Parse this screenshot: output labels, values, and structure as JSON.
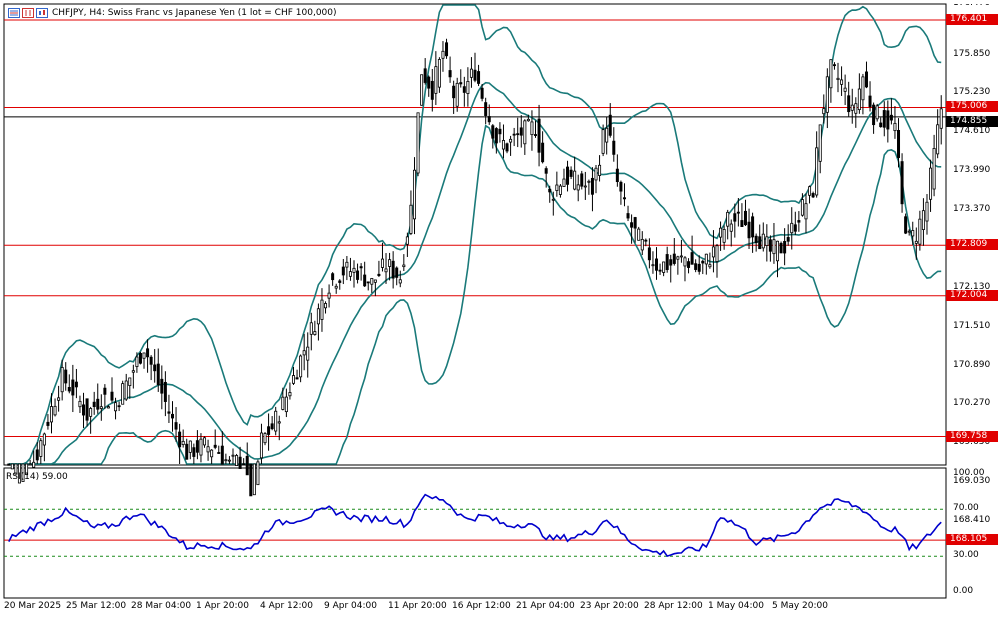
{
  "window": {
    "title": "CHFJPY, H4:  Swiss Franc vs Japanese Yen (1 lot = CHF 100,000)",
    "toolbar_icons": [
      "menu-icon",
      "bars-icon",
      "candles-icon"
    ]
  },
  "price_axis": {
    "ticks": [
      "175.850",
      "175.230",
      "174.610",
      "173.990",
      "173.370",
      "172.750",
      "172.130",
      "171.510",
      "170.890",
      "170.270",
      "169.650",
      "169.030",
      "168.410"
    ],
    "top_tick_partial": "176.470"
  },
  "horizontal_lines": [
    {
      "price": 176.401,
      "label": "176.401"
    },
    {
      "price": 175.006,
      "label": "175.006"
    },
    {
      "price": 172.809,
      "label": "172.809"
    },
    {
      "price": 172.004,
      "label": "172.004"
    },
    {
      "price": 169.758,
      "label": "169.758"
    },
    {
      "price": 168.105,
      "label": "168.105"
    }
  ],
  "current_price_label": "174.855",
  "rsi": {
    "label": "RSI(14) 59.00",
    "period": 14,
    "value": 59.0,
    "ticks": [
      "100.00",
      "70.00",
      "30.00",
      "0.00"
    ],
    "levels": [
      70,
      30
    ]
  },
  "time_axis": [
    "20 Mar 2025",
    "25 Mar 12:00",
    "28 Mar 04:00",
    "1 Apr 20:00",
    "4 Apr 12:00",
    "9 Apr 04:00",
    "11 Apr 20:00",
    "16 Apr 12:00",
    "21 Apr 04:00",
    "23 Apr 20:00",
    "28 Apr 12:00",
    "1 May 04:00",
    "5 May 20:00"
  ],
  "colors": {
    "bull": "#ffffff",
    "bear": "#000000",
    "bollinger": "#1a7a7a",
    "level_line": "#e00000",
    "rsi_line": "#0000cc",
    "rsi_level": "#1a8a1a",
    "badge_bg": "#e00000",
    "current_badge_bg": "#000000"
  },
  "chart_data": {
    "type": "candlestick",
    "symbol": "CHFJPY",
    "timeframe": "H4",
    "indicators": [
      "Bollinger Bands",
      "RSI(14)"
    ],
    "ylim": [
      168.1,
      176.5
    ],
    "close_path": [
      {
        "i": 0,
        "close": 168.6
      },
      {
        "i": 4,
        "close": 169.0
      },
      {
        "i": 8,
        "close": 169.5
      },
      {
        "i": 12,
        "close": 170.2
      },
      {
        "i": 15,
        "close": 170.7
      },
      {
        "i": 18,
        "close": 170.5
      },
      {
        "i": 22,
        "close": 170.1
      },
      {
        "i": 26,
        "close": 170.4
      },
      {
        "i": 30,
        "close": 170.3
      },
      {
        "i": 34,
        "close": 170.7
      },
      {
        "i": 38,
        "close": 171.2
      },
      {
        "i": 42,
        "close": 170.6
      },
      {
        "i": 46,
        "close": 170.0
      },
      {
        "i": 50,
        "close": 169.5
      },
      {
        "i": 54,
        "close": 169.6
      },
      {
        "i": 58,
        "close": 169.6
      },
      {
        "i": 62,
        "close": 169.3
      },
      {
        "i": 66,
        "close": 169.4
      },
      {
        "i": 68,
        "close": 168.6
      },
      {
        "i": 71,
        "close": 169.7
      },
      {
        "i": 74,
        "close": 169.9
      },
      {
        "i": 78,
        "close": 170.4
      },
      {
        "i": 82,
        "close": 171.0
      },
      {
        "i": 86,
        "close": 171.6
      },
      {
        "i": 90,
        "close": 172.2
      },
      {
        "i": 94,
        "close": 172.4
      },
      {
        "i": 98,
        "close": 172.4
      },
      {
        "i": 102,
        "close": 172.2
      },
      {
        "i": 106,
        "close": 172.5
      },
      {
        "i": 110,
        "close": 172.3
      },
      {
        "i": 113,
        "close": 173.4
      },
      {
        "i": 116,
        "close": 175.6
      },
      {
        "i": 119,
        "close": 175.3
      },
      {
        "i": 122,
        "close": 175.9
      },
      {
        "i": 125,
        "close": 175.2
      },
      {
        "i": 128,
        "close": 175.3
      },
      {
        "i": 131,
        "close": 175.6
      },
      {
        "i": 134,
        "close": 175.0
      },
      {
        "i": 137,
        "close": 174.5
      },
      {
        "i": 140,
        "close": 174.4
      },
      {
        "i": 144,
        "close": 174.6
      },
      {
        "i": 148,
        "close": 174.7
      },
      {
        "i": 152,
        "close": 173.6
      },
      {
        "i": 156,
        "close": 173.9
      },
      {
        "i": 160,
        "close": 173.8
      },
      {
        "i": 164,
        "close": 173.7
      },
      {
        "i": 168,
        "close": 174.8
      },
      {
        "i": 171,
        "close": 173.8
      },
      {
        "i": 174,
        "close": 173.2
      },
      {
        "i": 178,
        "close": 172.8
      },
      {
        "i": 182,
        "close": 172.5
      },
      {
        "i": 186,
        "close": 172.5
      },
      {
        "i": 190,
        "close": 172.6
      },
      {
        "i": 194,
        "close": 172.4
      },
      {
        "i": 198,
        "close": 172.7
      },
      {
        "i": 202,
        "close": 173.2
      },
      {
        "i": 206,
        "close": 173.2
      },
      {
        "i": 210,
        "close": 173.0
      },
      {
        "i": 214,
        "close": 172.7
      },
      {
        "i": 218,
        "close": 172.8
      },
      {
        "i": 222,
        "close": 173.3
      },
      {
        "i": 226,
        "close": 173.7
      },
      {
        "i": 228,
        "close": 174.8
      },
      {
        "i": 231,
        "close": 175.6
      },
      {
        "i": 234,
        "close": 175.4
      },
      {
        "i": 237,
        "close": 174.9
      },
      {
        "i": 240,
        "close": 175.5
      },
      {
        "i": 243,
        "close": 174.9
      },
      {
        "i": 246,
        "close": 174.8
      },
      {
        "i": 249,
        "close": 174.7
      },
      {
        "i": 251,
        "close": 173.4
      },
      {
        "i": 253,
        "close": 172.9
      },
      {
        "i": 255,
        "close": 173.0
      },
      {
        "i": 258,
        "close": 173.5
      },
      {
        "i": 262,
        "close": 175.0
      }
    ],
    "rsi_path": [
      {
        "i": 0,
        "v": 45
      },
      {
        "i": 12,
        "v": 62
      },
      {
        "i": 16,
        "v": 68
      },
      {
        "i": 24,
        "v": 54
      },
      {
        "i": 30,
        "v": 57
      },
      {
        "i": 36,
        "v": 67
      },
      {
        "i": 44,
        "v": 52
      },
      {
        "i": 50,
        "v": 38
      },
      {
        "i": 56,
        "v": 40
      },
      {
        "i": 62,
        "v": 38
      },
      {
        "i": 68,
        "v": 36
      },
      {
        "i": 74,
        "v": 57
      },
      {
        "i": 82,
        "v": 62
      },
      {
        "i": 90,
        "v": 70
      },
      {
        "i": 98,
        "v": 62
      },
      {
        "i": 106,
        "v": 62
      },
      {
        "i": 112,
        "v": 57
      },
      {
        "i": 116,
        "v": 80
      },
      {
        "i": 122,
        "v": 79
      },
      {
        "i": 128,
        "v": 62
      },
      {
        "i": 134,
        "v": 64
      },
      {
        "i": 140,
        "v": 56
      },
      {
        "i": 146,
        "v": 58
      },
      {
        "i": 152,
        "v": 45
      },
      {
        "i": 158,
        "v": 46
      },
      {
        "i": 164,
        "v": 51
      },
      {
        "i": 168,
        "v": 62
      },
      {
        "i": 174,
        "v": 44
      },
      {
        "i": 180,
        "v": 34
      },
      {
        "i": 186,
        "v": 32
      },
      {
        "i": 190,
        "v": 34
      },
      {
        "i": 196,
        "v": 38
      },
      {
        "i": 200,
        "v": 65
      },
      {
        "i": 206,
        "v": 54
      },
      {
        "i": 210,
        "v": 42
      },
      {
        "i": 216,
        "v": 45
      },
      {
        "i": 222,
        "v": 53
      },
      {
        "i": 228,
        "v": 72
      },
      {
        "i": 234,
        "v": 77
      },
      {
        "i": 240,
        "v": 70
      },
      {
        "i": 246,
        "v": 54
      },
      {
        "i": 250,
        "v": 52
      },
      {
        "i": 253,
        "v": 36
      },
      {
        "i": 256,
        "v": 40
      },
      {
        "i": 262,
        "v": 59
      }
    ]
  }
}
